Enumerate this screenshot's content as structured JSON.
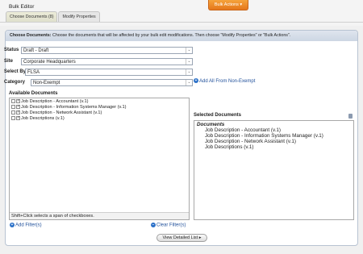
{
  "app": {
    "title": "Bulk Editor",
    "bulk_actions_label": "Bulk Actions"
  },
  "tabs": [
    {
      "label": "Choose Documents (8)"
    },
    {
      "label": "Modify Properties"
    }
  ],
  "panel": {
    "heading": "Choose Documents:",
    "instruction": " Choose the documents that will be affected by your bulk edit modifications. Then choose \"Modify Properties\" or \"Bulk Actions\"."
  },
  "filters": {
    "status": {
      "label": "Status",
      "value": "Draft - Draft"
    },
    "site": {
      "label": "Site",
      "value": "Corporate Headquarters"
    },
    "select_by": {
      "label": "Select By",
      "value": "FLSA"
    },
    "category": {
      "label": "Category",
      "value": "Non-Exempt"
    },
    "add_all_label": "Add All From Non-Exempt"
  },
  "available": {
    "title": "Available Documents",
    "items": [
      "Job Description - Accountant (v.1)",
      "Job Description - Information Systems Manager (v.1)",
      "Job Description - Network Assistant (v.1)",
      "Job Descriptions (v.1)"
    ],
    "hint": "Shift+Click selects a span of checkboxes."
  },
  "selected": {
    "title": "Selected Documents",
    "heading": "Documents",
    "items": [
      "Job Description - Accountant (v.1)",
      "Job Description - Information Systems Manager (v.1)",
      "Job Description - Network Assistant (v.1)",
      "Job Descriptions (v.1)"
    ]
  },
  "actions": {
    "add_filter": "Add Filter(s)",
    "clear_filter": "Clear Filter(s)",
    "view_list": "View Detailed List"
  },
  "colors": {
    "accent": "#f08a25",
    "link": "#1f4f9a",
    "panel_border": "#b8c3d2"
  }
}
